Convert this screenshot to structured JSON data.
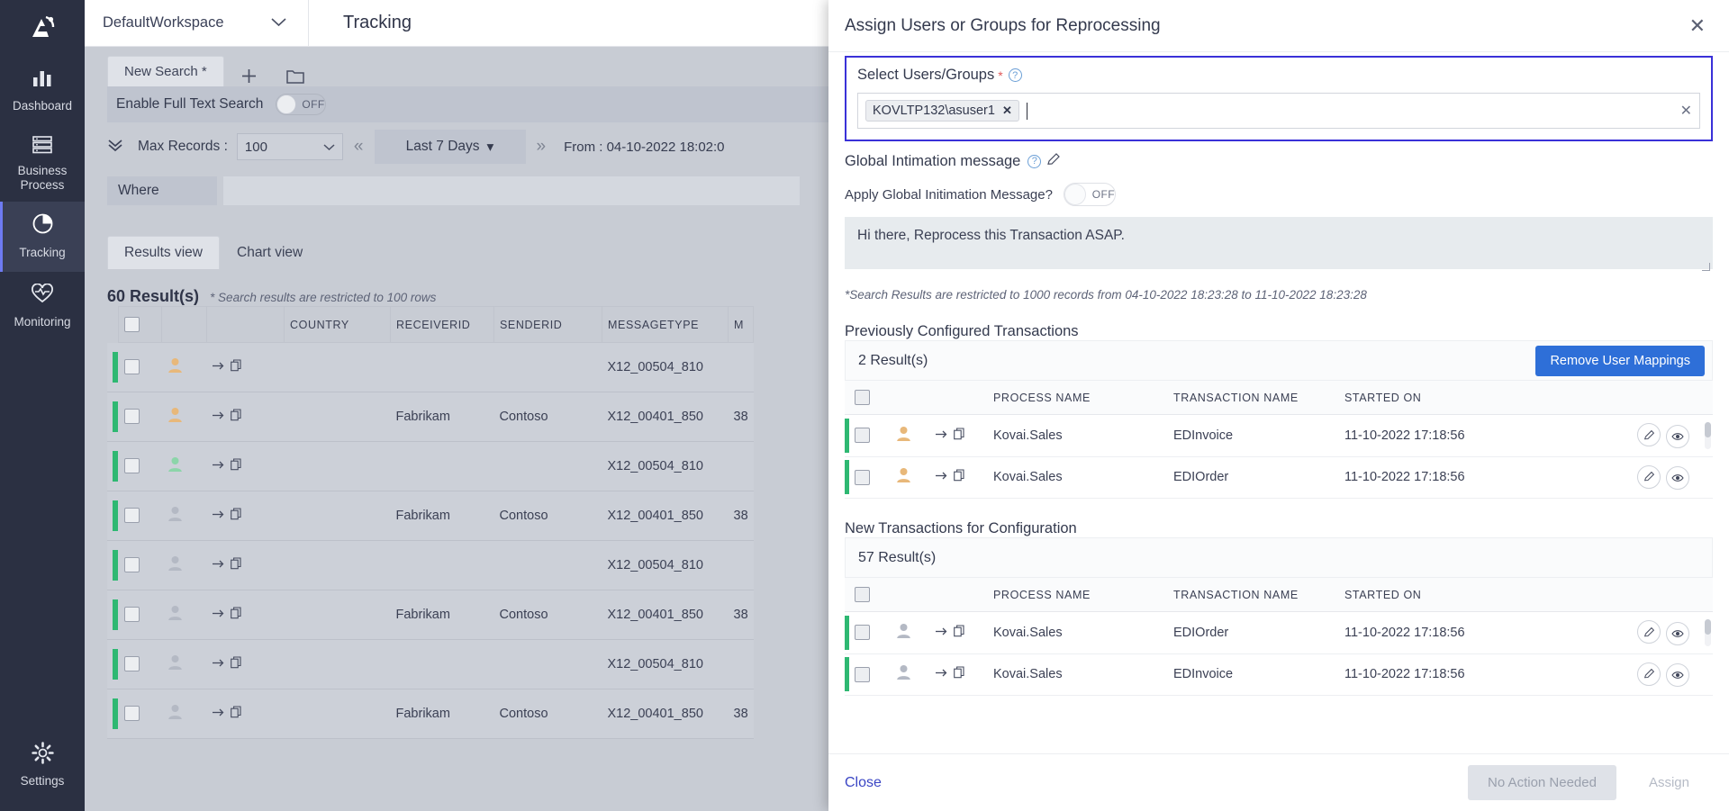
{
  "sidebar": {
    "logo_name": "app-logo-icon",
    "items": [
      {
        "label": "Dashboard",
        "icon": "bar-chart-icon",
        "active": false
      },
      {
        "label": "Business Process",
        "icon": "server-stack-icon",
        "active": false
      },
      {
        "label": "Tracking",
        "icon": "pie-chart-icon",
        "active": true
      },
      {
        "label": "Monitoring",
        "icon": "heart-pulse-icon",
        "active": false
      }
    ],
    "settings": {
      "label": "Settings",
      "icon": "gear-icon"
    }
  },
  "topbar": {
    "workspace": "DefaultWorkspace",
    "page_title": "Tracking"
  },
  "search": {
    "tab_label": "New Search *",
    "add_icon": "plus-icon",
    "folder_icon": "folder-open-icon",
    "fulltext_label": "Enable Full Text Search",
    "fulltext_state": "OFF",
    "max_records_label": "Max Records :",
    "max_records_value": "100",
    "range_label": "Last 7 Days",
    "from_label": "From : 04-10-2022 18:02:0",
    "where_label": "Where",
    "where_value": ""
  },
  "views": {
    "tabs": [
      {
        "label": "Results view",
        "active": true
      },
      {
        "label": "Chart view",
        "active": false
      }
    ]
  },
  "results": {
    "count_label": "60 Result(s)",
    "note": "* Search results are restricted to 100 rows",
    "columns": [
      "",
      "",
      "",
      "COUNTRY",
      "RECEIVERID",
      "SENDERID",
      "MESSAGETYPE",
      "M"
    ],
    "rows": [
      {
        "avatar": "orange",
        "country": "",
        "receiverid": "",
        "senderid": "",
        "messagetype": "X12_00504_810",
        "extra": ""
      },
      {
        "avatar": "orange",
        "country": "",
        "receiverid": "Fabrikam",
        "senderid": "Contoso",
        "messagetype": "X12_00401_850",
        "extra": "38"
      },
      {
        "avatar": "green",
        "country": "",
        "receiverid": "",
        "senderid": "",
        "messagetype": "X12_00504_810",
        "extra": ""
      },
      {
        "avatar": "grey",
        "country": "",
        "receiverid": "Fabrikam",
        "senderid": "Contoso",
        "messagetype": "X12_00401_850",
        "extra": "38"
      },
      {
        "avatar": "grey",
        "country": "",
        "receiverid": "",
        "senderid": "",
        "messagetype": "X12_00504_810",
        "extra": ""
      },
      {
        "avatar": "grey",
        "country": "",
        "receiverid": "Fabrikam",
        "senderid": "Contoso",
        "messagetype": "X12_00401_850",
        "extra": "38"
      },
      {
        "avatar": "grey",
        "country": "",
        "receiverid": "",
        "senderid": "",
        "messagetype": "X12_00504_810",
        "extra": ""
      },
      {
        "avatar": "grey",
        "country": "",
        "receiverid": "Fabrikam",
        "senderid": "Contoso",
        "messagetype": "X12_00401_850",
        "extra": "38"
      }
    ]
  },
  "panel": {
    "title": "Assign Users or Groups for Reprocessing",
    "close_icon": "close-icon",
    "select_users": {
      "label": "Select Users/Groups",
      "required_marker": "*",
      "help_icon": "help-circle-icon",
      "token": "KOVLTP132\\asuser1",
      "token_remove_icon": "token-remove-icon",
      "clear_icon": "clear-icon",
      "input_value": ""
    },
    "global_message": {
      "title": "Global Intimation message",
      "help_icon": "help-circle-icon",
      "edit_icon": "pencil-icon",
      "apply_label": "Apply Global Initimation Message?",
      "apply_state": "OFF",
      "message_text": "Hi there, Reprocess this Transaction ASAP."
    },
    "restrict_note": "*Search Results are restricted to 1000 records from 04-10-2022 18:23:28 to 11-10-2022 18:23:28",
    "previous_section": {
      "title": "Previously Configured Transactions",
      "count_label": "2 Result(s)",
      "action_button": "Remove User Mappings",
      "columns": [
        "",
        "",
        "",
        "PROCESS NAME",
        "TRANSACTION NAME",
        "STARTED ON",
        ""
      ],
      "rows": [
        {
          "avatar": "orange",
          "process": "Kovai.Sales",
          "transaction": "EDInvoice",
          "started": "11-10-2022 17:18:56",
          "edit_icon": "pencil-icon",
          "view_icon": "eye-icon"
        },
        {
          "avatar": "orange",
          "process": "Kovai.Sales",
          "transaction": "EDIOrder",
          "started": "11-10-2022 17:18:56",
          "edit_icon": "pencil-icon",
          "view_icon": "eye-icon"
        }
      ]
    },
    "new_section": {
      "title": "New Transactions for Configuration",
      "count_label": "57 Result(s)",
      "columns": [
        "",
        "",
        "",
        "PROCESS NAME",
        "TRANSACTION NAME",
        "STARTED ON",
        ""
      ],
      "rows": [
        {
          "avatar": "grey",
          "process": "Kovai.Sales",
          "transaction": "EDIOrder",
          "started": "11-10-2022 17:18:56",
          "edit_icon": "pencil-icon",
          "view_icon": "eye-icon"
        },
        {
          "avatar": "grey",
          "process": "Kovai.Sales",
          "transaction": "EDInvoice",
          "started": "11-10-2022 17:18:56",
          "edit_icon": "pencil-icon",
          "view_icon": "eye-icon"
        }
      ]
    },
    "footer": {
      "close_label": "Close",
      "no_action_label": "No Action Needed",
      "assign_label": "Assign"
    }
  },
  "colors": {
    "accent_blue": "#2e6fd8",
    "focus_border": "#3a31d8",
    "status_green": "#2eb872",
    "sidebar_bg": "#2b3042",
    "link": "#3a45c4"
  }
}
